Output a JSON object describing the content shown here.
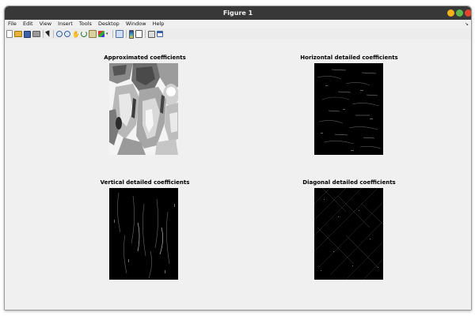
{
  "window": {
    "title": "Figure 1",
    "buttons": [
      "minimize",
      "maximize",
      "close"
    ]
  },
  "menubar": {
    "items": [
      {
        "label": "File"
      },
      {
        "label": "Edit"
      },
      {
        "label": "View"
      },
      {
        "label": "Insert"
      },
      {
        "label": "Tools"
      },
      {
        "label": "Desktop"
      },
      {
        "label": "Window"
      },
      {
        "label": "Help"
      }
    ],
    "dock_arrow": "↘"
  },
  "toolbar": {
    "icons": [
      "new-figure-icon",
      "open-file-icon",
      "save-icon",
      "print-icon",
      "edit-plot-arrow-icon",
      "zoom-in-icon",
      "zoom-out-icon",
      "pan-icon",
      "rotate-3d-icon",
      "data-cursor-icon",
      "brush-icon",
      "link-plot-icon",
      "colorbar-icon",
      "legend-icon",
      "grid-icon",
      "dock-icon"
    ]
  },
  "subplots": [
    {
      "title": "Approximated coefficients",
      "image": "approximation"
    },
    {
      "title": "Horizontal detailed coefficients",
      "image": "horizontal"
    },
    {
      "title": "Vertical detailed coefficients",
      "image": "vertical"
    },
    {
      "title": "Diagonal detailed coefficients",
      "image": "diagonal"
    }
  ],
  "colors": {
    "titlebar": "#383838",
    "window_bg": "#f0f0f0",
    "minimize": "#f5b21b",
    "maximize": "#5cb94a",
    "close": "#e0462e"
  }
}
